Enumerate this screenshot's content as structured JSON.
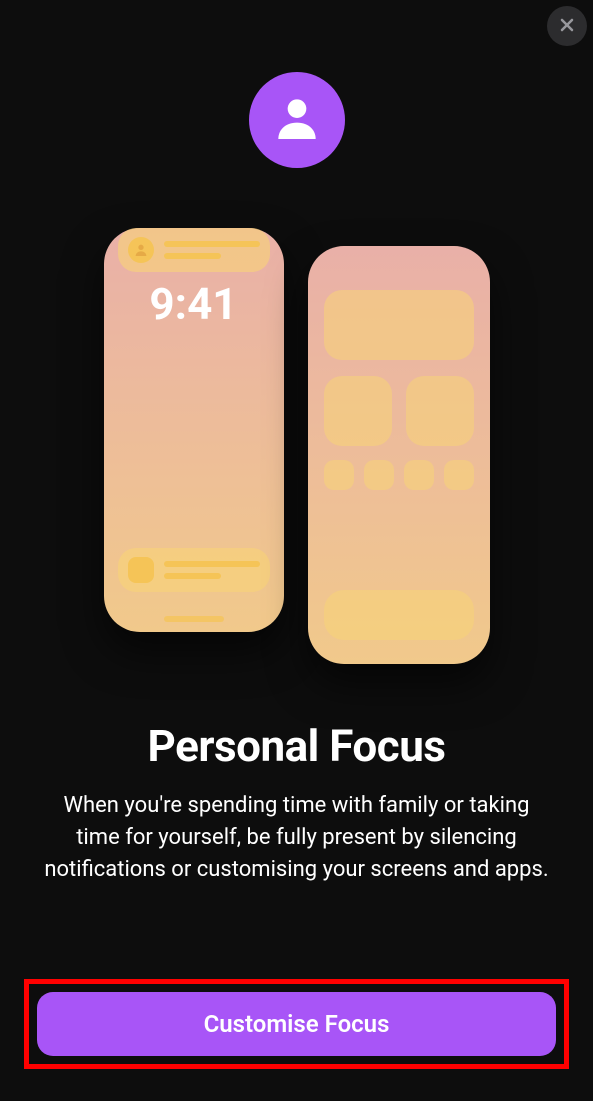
{
  "close": {
    "semantic": "close"
  },
  "avatar": {
    "semantic": "person"
  },
  "preview": {
    "phone_left": {
      "time": "9:41"
    }
  },
  "title": "Personal Focus",
  "description": "When you're spending time with family or taking time for yourself, be fully present by silencing notifications or customising your screens and apps.",
  "button": {
    "label": "Customise Focus"
  },
  "colors": {
    "accent": "#a855f7",
    "highlight": "#ff0000",
    "background": "#0d0d0d"
  }
}
